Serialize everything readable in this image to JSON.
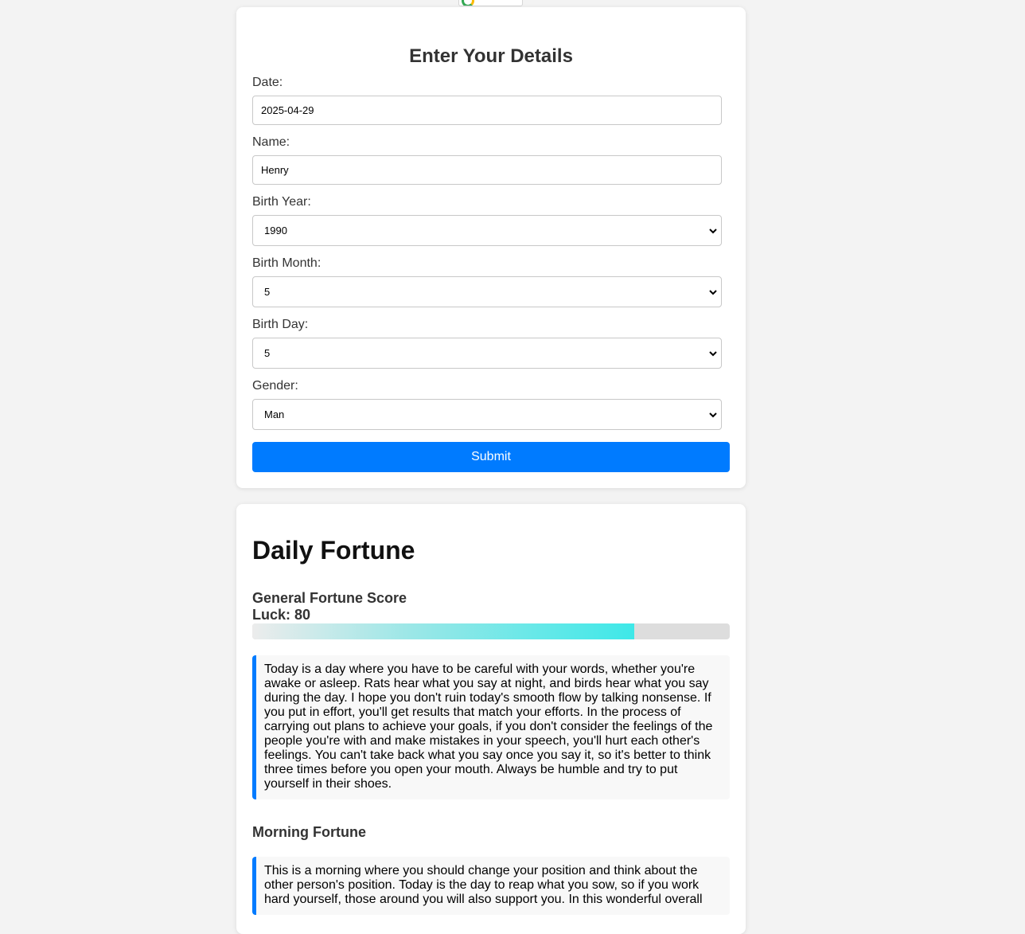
{
  "form": {
    "title": "Enter Your Details",
    "date_label": "Date:",
    "date_value": "2025-04-29",
    "name_label": "Name:",
    "name_value": "Henry",
    "birth_year_label": "Birth Year:",
    "birth_year_value": "1990",
    "birth_month_label": "Birth Month:",
    "birth_month_value": "5",
    "birth_day_label": "Birth Day:",
    "birth_day_value": "5",
    "gender_label": "Gender:",
    "gender_value": "Man",
    "submit_label": "Submit"
  },
  "result": {
    "title": "Daily Fortune",
    "general_heading": "General Fortune Score",
    "luck_text": "Luck: 80",
    "luck_value": 80,
    "luck_max": 100,
    "general_text": "Today is a day where you have to be careful with your words, whether you're awake or asleep. Rats hear what you say at night, and birds hear what you say during the day. I hope you don't ruin today's smooth flow by talking nonsense. If you put in effort, you'll get results that match your efforts. In the process of carrying out plans to achieve your goals, if you don't consider the feelings of the people you're with and make mistakes in your speech, you'll hurt each other's feelings. You can't take back what you say once you say it, so it's better to think three times before you open your mouth. Always be humble and try to put yourself in their shoes.",
    "morning_heading": "Morning Fortune",
    "morning_text": "This is a morning where you should change your position and think about the other person's position. Today is the day to reap what you sow, so if you work hard yourself, those around you will also support you. In this wonderful overall"
  },
  "colors": {
    "accent": "#007bff",
    "page_background": "#f3f3f3",
    "luck_bar_end": "#3ee8e8"
  },
  "icons": {
    "select_arrow": "chevron-down-icon",
    "top_badge": "google-icon"
  }
}
